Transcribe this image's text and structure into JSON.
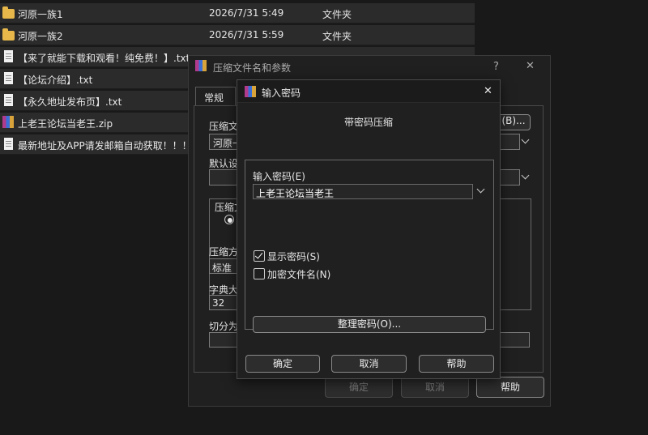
{
  "files": [
    {
      "icon": "folder-icon",
      "name": "河原一族1",
      "date": "2026/7/31 5:49",
      "type": "文件夹",
      "size": ""
    },
    {
      "icon": "folder-icon",
      "name": "河原一族2",
      "date": "2026/7/31 5:59",
      "type": "文件夹",
      "size": ""
    },
    {
      "icon": "text-file-icon",
      "name": "【来了就能下载和观看！纯免费！】.txt",
      "date": "",
      "type": "",
      "size": ""
    },
    {
      "icon": "text-file-icon",
      "name": "【论坛介绍】.txt",
      "date": "",
      "type": "",
      "size": ""
    },
    {
      "icon": "text-file-icon",
      "name": "【永久地址发布页】.txt",
      "date": "",
      "type": "",
      "size": ""
    },
    {
      "icon": "winrar-archive-icon",
      "name": "上老王论坛当老王.zip",
      "date": "",
      "type": "",
      "size": ""
    },
    {
      "icon": "text-file-icon",
      "name": "最新地址及APP请发邮箱自动获取！！！",
      "date": "",
      "type": "",
      "size": ""
    }
  ],
  "archive_dialog": {
    "title": "压缩文件名和参数",
    "help_glyph": "?",
    "close_glyph": "✕",
    "tab_general": "常规",
    "archive_name_label": "压缩文",
    "archive_name_value": "河原一",
    "browse_label": "(B)...",
    "default_settings_label": "默认设",
    "format_group_label": "压缩文",
    "method_label": "压缩方",
    "method_value": "标准",
    "dict_label": "字典大",
    "dict_value": "32",
    "split_label": "切分为",
    "ok_label": "确定",
    "cancel_label": "取消",
    "help_label": "帮助"
  },
  "password_dialog": {
    "title": "输入密码",
    "close_glyph": "✕",
    "heading": "带密码压缩",
    "password_label": "输入密码(E)",
    "password_value": "上老王论坛当老王",
    "show_password_label": "显示密码(S)",
    "show_password_checked": true,
    "encrypt_names_label": "加密文件名(N)",
    "encrypt_names_checked": false,
    "organize_label": "整理密码(O)...",
    "ok_label": "确定",
    "cancel_label": "取消",
    "help_label": "帮助"
  }
}
